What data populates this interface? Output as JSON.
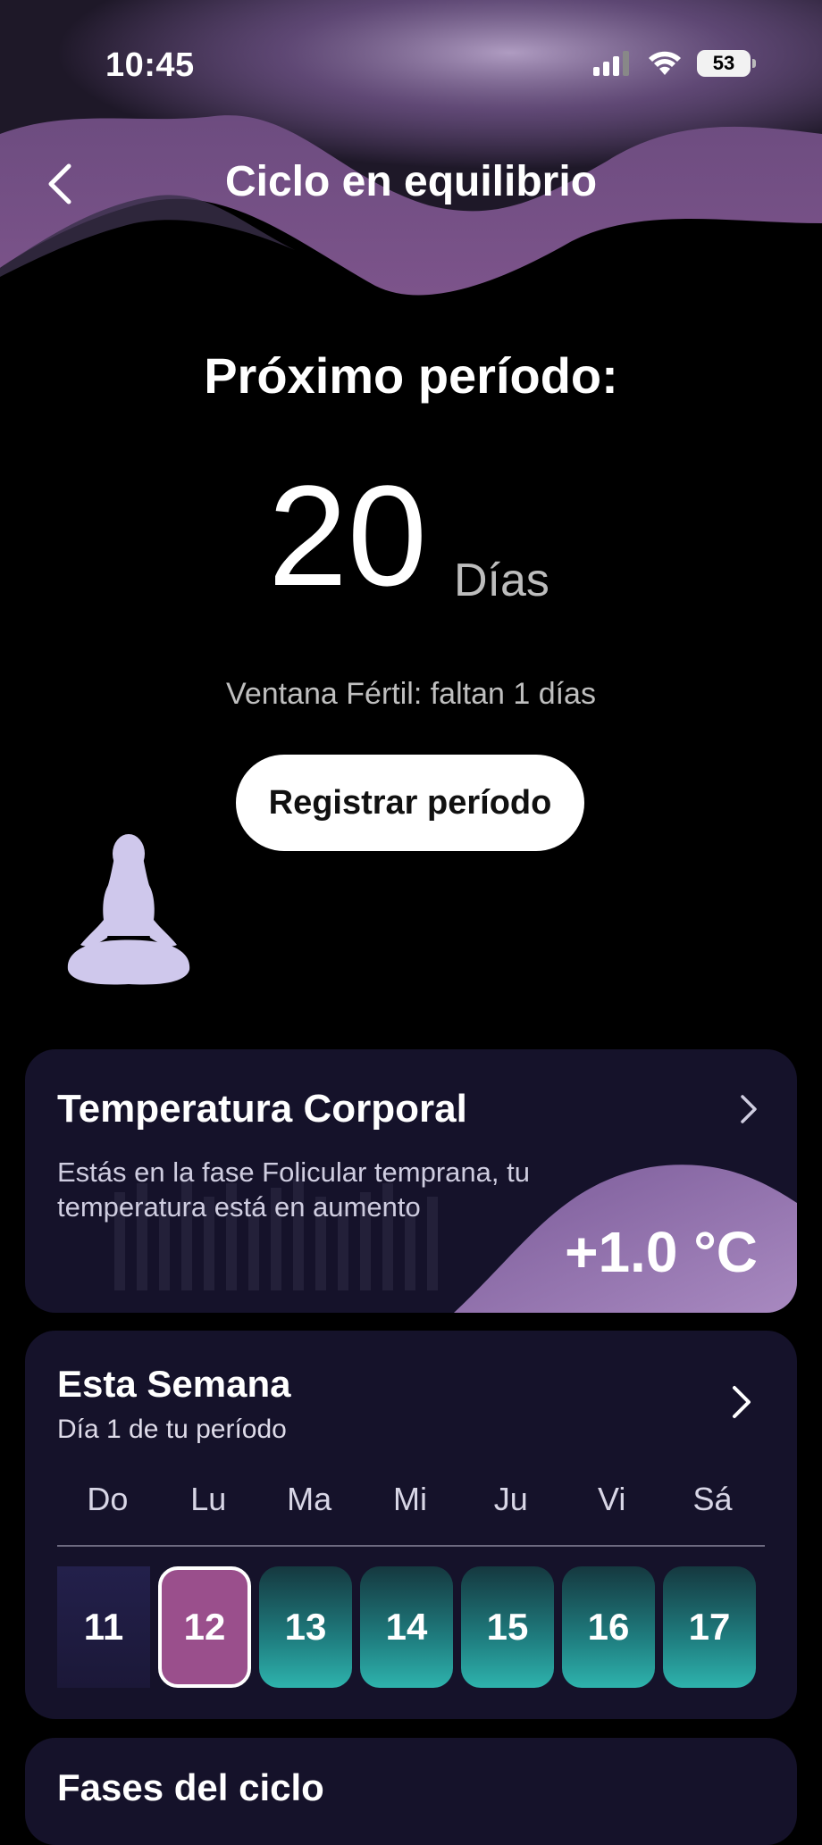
{
  "status_bar": {
    "time": "10:45",
    "battery": "53"
  },
  "header": {
    "title": "Ciclo en equilibrio"
  },
  "next_period": {
    "label": "Próximo período:",
    "days": "20",
    "days_unit": "Días",
    "fertile_window": "Ventana Fértil: faltan 1 días",
    "register_button": "Registrar período"
  },
  "temperature_card": {
    "title": "Temperatura Corporal",
    "description": "Estás en la fase Folicular temprana, tu temperatura está en aumento",
    "value": "+1.0 °C"
  },
  "week_card": {
    "title": "Esta Semana",
    "subtitle": "Día 1 de tu período",
    "weekdays": [
      "Do",
      "Lu",
      "Ma",
      "Mi",
      "Ju",
      "Vi",
      "Sá"
    ],
    "dates": [
      {
        "day": "11",
        "state": "past"
      },
      {
        "day": "12",
        "state": "today"
      },
      {
        "day": "13",
        "state": "future"
      },
      {
        "day": "14",
        "state": "future"
      },
      {
        "day": "15",
        "state": "future"
      },
      {
        "day": "16",
        "state": "future"
      },
      {
        "day": "17",
        "state": "future"
      }
    ]
  },
  "phases_card": {
    "title": "Fases del ciclo"
  },
  "colors": {
    "background": "#000000",
    "card": "#15122a",
    "accent_purple": "#9a4f8c",
    "accent_teal": "#2eb3ad"
  }
}
